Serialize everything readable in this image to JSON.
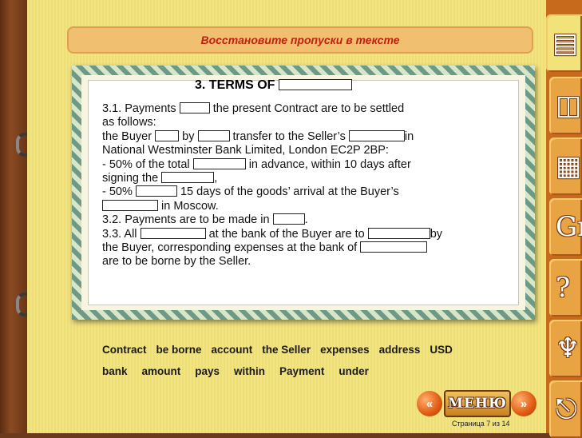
{
  "header": {
    "title": "Восстановите пропуски в тексте"
  },
  "document": {
    "heading": "3. TERMS OF",
    "lines": {
      "l1a": "3.1. Payments",
      "l1b": "the present Contract are to be settled",
      "l2": "as follows:",
      "l3a": "the Buyer",
      "l3b": "by",
      "l3c": "transfer to the Seller’s",
      "l3d": "in",
      "l4": "National Westminster Bank Limited, London EC2P 2BP:",
      "l5a": "- 50% of the total",
      "l5b": "in advance, within 10 days after",
      "l6a": "signing the",
      "l6b": ",",
      "l7a": "- 50%",
      "l7b": "15 days of the goods’ arrival at the Buyer’s",
      "l8": "in Moscow.",
      "l9a": "3.2. Payments are to be made in",
      "l9b": ".",
      "l10a": "3.3. All",
      "l10b": "at the bank of the Buyer are to",
      "l10c": "by",
      "l11": "the Buyer, corresponding expenses at the bank of",
      "l12": "are to be borne by the Seller."
    }
  },
  "word_bank": {
    "row1": [
      "Contract",
      "be borne",
      "account",
      "the Seller",
      "expenses",
      "address",
      "USD"
    ],
    "row2": [
      "bank",
      "amount",
      "pays",
      "within",
      "Payment",
      "under"
    ]
  },
  "nav": {
    "prev_label": "«",
    "next_label": "»",
    "menu_label": "МЕНЮ",
    "page_indicator": "Страница 7 из 14"
  },
  "tabs": [
    {
      "icon": "document-icon",
      "glyph": "▤"
    },
    {
      "icon": "book-icon",
      "glyph": "◫"
    },
    {
      "icon": "pages-icon",
      "glyph": "▦"
    },
    {
      "icon": "grammar-icon",
      "glyph": "Gr"
    },
    {
      "icon": "question-icon",
      "glyph": "?"
    },
    {
      "icon": "trophy-icon",
      "glyph": "♆"
    },
    {
      "icon": "exit-icon",
      "glyph": "⎋"
    }
  ]
}
